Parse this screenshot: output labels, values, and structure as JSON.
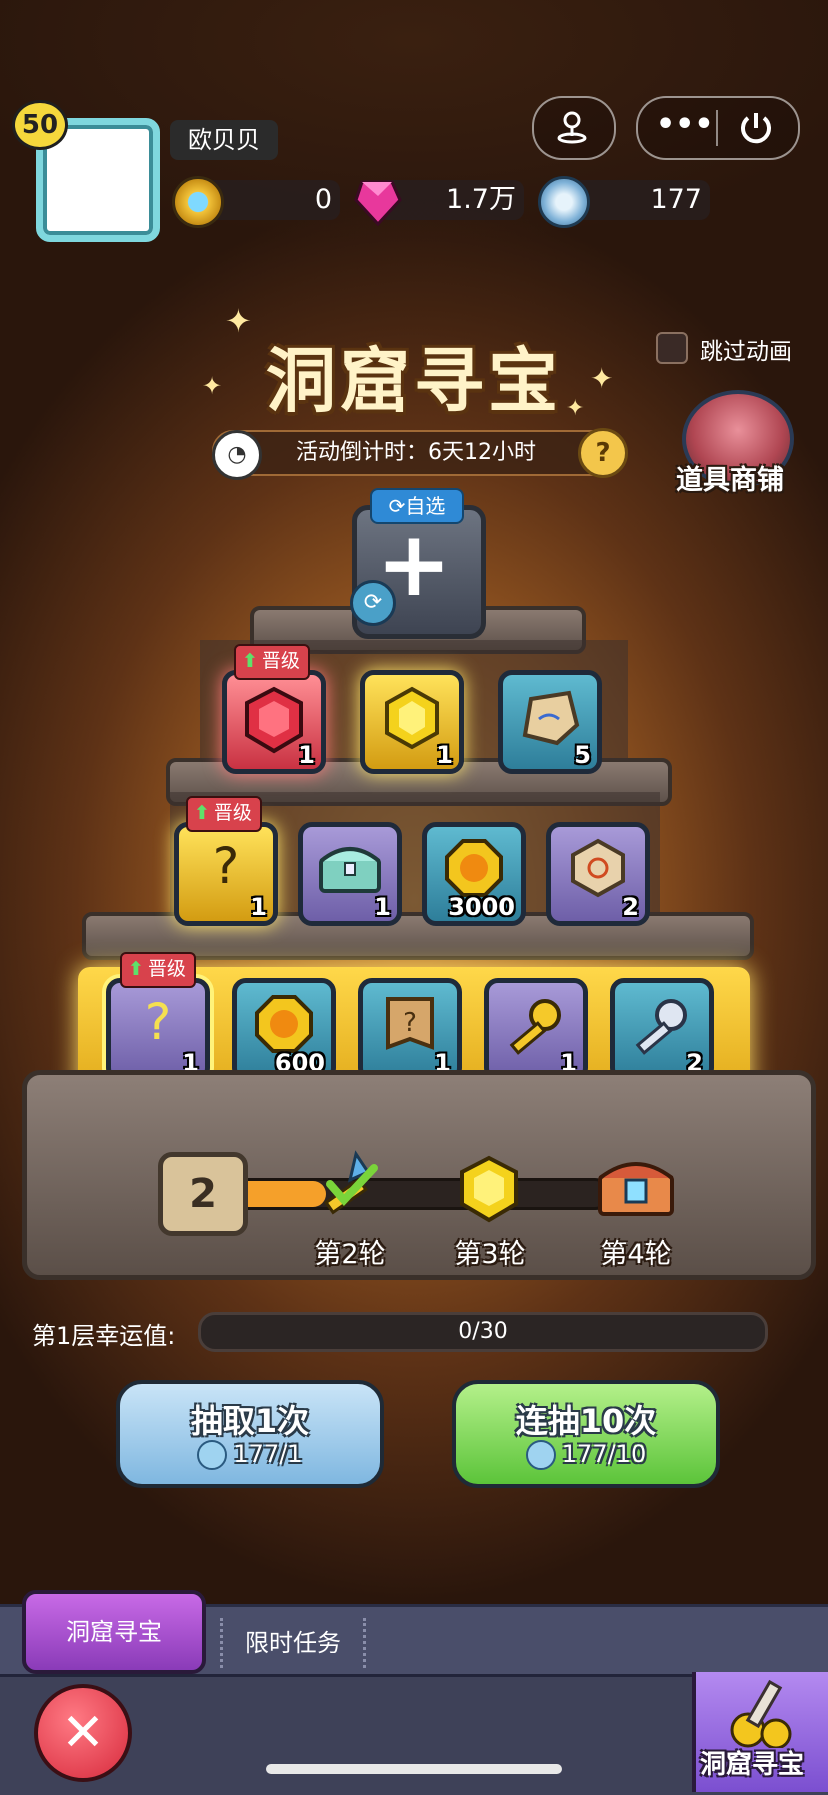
{
  "header": {
    "level": "50",
    "username": "欧贝贝",
    "resources": [
      {
        "icon": "gem-coin-icon",
        "value": "0"
      },
      {
        "icon": "pink-crystal-icon",
        "value": "1.7万"
      },
      {
        "icon": "cave-ticket-icon",
        "value": "177"
      }
    ]
  },
  "top_buttons": {
    "location_icon": "location-icon",
    "more_icon": "more-icon",
    "power_icon": "power-icon"
  },
  "event": {
    "title": "洞窟寻宝",
    "countdown": "活动倒计时：6天12小时",
    "skip_animation": "跳过动画",
    "shop_label": "道具商铺"
  },
  "pyramid": {
    "choose_tag": "自选",
    "upgrade_label": "晋级",
    "row1": [
      {
        "name": "red-gem-icon",
        "count": "1"
      },
      {
        "name": "gold-gem-icon",
        "count": "1"
      },
      {
        "name": "rune-stone-icon",
        "count": "5"
      }
    ],
    "row2": [
      {
        "name": "random-gems-icon",
        "count": "1"
      },
      {
        "name": "treasure-chest-icon",
        "count": "1"
      },
      {
        "name": "gold-coin-icon",
        "count": "3000"
      },
      {
        "name": "sun-rune-icon",
        "count": "2"
      }
    ],
    "row3": [
      {
        "name": "random-gems-icon",
        "count": "1"
      },
      {
        "name": "gold-coin-icon",
        "count": "600"
      },
      {
        "name": "mystery-scroll-icon",
        "count": "1"
      },
      {
        "name": "gold-key-icon",
        "count": "1"
      },
      {
        "name": "silver-key-icon",
        "count": "2"
      }
    ]
  },
  "progress": {
    "current_round": "2",
    "fill_fraction": 0.25,
    "milestones": [
      "第2轮",
      "第3轮",
      "第4轮"
    ]
  },
  "luck": {
    "label": "第1层幸运值:",
    "value": "0/30",
    "fraction": 0
  },
  "draw": {
    "one": {
      "label": "抽取1次",
      "cost": "177/1"
    },
    "ten": {
      "label": "连抽10次",
      "cost": "177/10"
    }
  },
  "tabs": {
    "active": "洞窟寻宝",
    "inactive": "限时任务"
  },
  "dock": {
    "feature_label": "洞窟寻宝"
  }
}
